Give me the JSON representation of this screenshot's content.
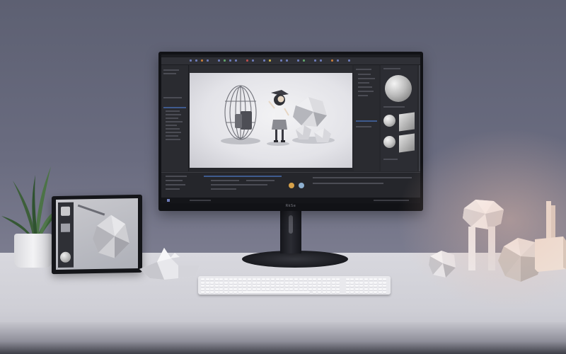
{
  "scene": {
    "kind": "desk-setup-photo",
    "colors": {
      "wall": "#65677a",
      "desk": "#d4d4da",
      "monitor_bezel": "#111216",
      "ui_accent": "#3f5b8e",
      "warm_light": "#ebbeaa"
    }
  },
  "monitor": {
    "brand": "RkSe",
    "app": {
      "type": "3d-modeling-application",
      "viewport_objects": [
        "wireframe-egg-chair",
        "stylized-character",
        "low-poly-rocks"
      ],
      "material_previews": [
        "sphere-large",
        "sphere-small",
        "swatch",
        "sphere-small",
        "swatch"
      ]
    }
  },
  "desk_items": [
    "plant-in-pot",
    "tablet",
    "low-poly-sculpture",
    "keyboard",
    "low-poly-figure",
    "low-poly-sphere",
    "low-poly-pebble",
    "blocks"
  ],
  "icons": [
    "brand-logo-icon"
  ]
}
